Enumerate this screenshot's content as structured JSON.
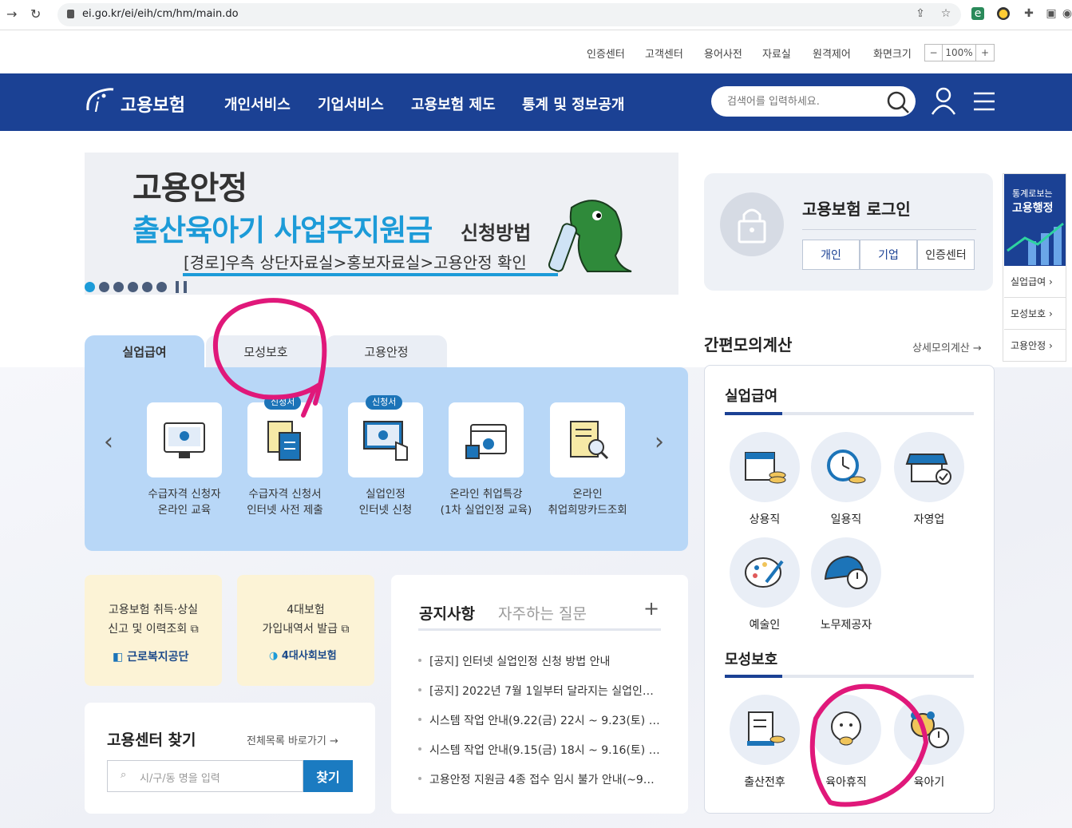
{
  "browser": {
    "url": "ei.go.kr/ei/eih/cm/hm/main.do"
  },
  "util_links": [
    "인증센터",
    "고객센터",
    "용어사전",
    "자료실",
    "원격제어",
    "화면크기"
  ],
  "zoom": {
    "minus": "−",
    "value": "100%",
    "plus": "+"
  },
  "header": {
    "logo": "고용보험",
    "nav": [
      "개인서비스",
      "기업서비스",
      "고용보험 제도",
      "통계 및 정보공개"
    ],
    "search_placeholder": "검색어를 입력하세요."
  },
  "banner": {
    "line1": "고용안정",
    "line2": "출산육아기 사업주지원금",
    "line2_suffix": "신청방법",
    "line3": "[경로]우측 상단자료실>홍보자료실>고용안정 확인"
  },
  "tabs": [
    "실업급여",
    "모성보호",
    "고용안정"
  ],
  "services": [
    {
      "label1": "수급자격 신청자",
      "label2": "온라인 교육",
      "badge": ""
    },
    {
      "label1": "수급자격 신청서",
      "label2": "인터넷 사전 제출",
      "badge": "신청서"
    },
    {
      "label1": "실업인정",
      "label2": "인터넷 신청",
      "badge": "신청서"
    },
    {
      "label1": "온라인 취업특강",
      "label2": "(1차 실업인정 교육)",
      "badge": ""
    },
    {
      "label1": "온라인",
      "label2": "취업희망카드조회",
      "badge": ""
    }
  ],
  "cards": {
    "card1_line1": "고용보험 취득·상실",
    "card1_line2": "신고 및 이력조회",
    "card1_org": "근로복지공단",
    "card2_line1": "4대보험",
    "card2_line2": "가입내역서 발급",
    "card2_org": "4대사회보험"
  },
  "finder": {
    "title": "고용센터 찾기",
    "all_link": "전체목록 바로가기",
    "placeholder": "시/구/동 명을 입력",
    "button": "찾기"
  },
  "notice": {
    "tab_active": "공지사항",
    "tab_other": "자주하는 질문",
    "plus": "+",
    "items": [
      "[공지] 인터넷 실업인정 신청 방법 안내",
      "[공지] 2022년 7월 1일부터 달라지는 실업인…",
      "시스템 작업 안내(9.22(금) 22시 ~ 9.23(토) …",
      "시스템 작업 안내(9.15(금) 18시 ~ 9.16(토) …",
      "고용안정 지원금 4종 접수 임시 불가 안내(~9…"
    ]
  },
  "login": {
    "title": "고용보험 로그인",
    "buttons": [
      "개인",
      "기업",
      "인증센터"
    ]
  },
  "calc": {
    "title": "간편모의계산",
    "detail_link": "상세모의계산",
    "sec1": "실업급여",
    "sec1_items": [
      "상용직",
      "일용직",
      "자영업",
      "예술인",
      "노무제공자"
    ],
    "sec2": "모성보호",
    "sec2_items": [
      "출산전후",
      "육아휴직",
      "육아기"
    ]
  },
  "quick": {
    "top1": "통계로보는",
    "top2": "고용행정",
    "items": [
      "실업급여",
      "모성보호",
      "고용안정"
    ]
  },
  "colors": {
    "brand": "#1b4194",
    "accent": "#1c9bd8",
    "annotation": "#e0187a"
  }
}
